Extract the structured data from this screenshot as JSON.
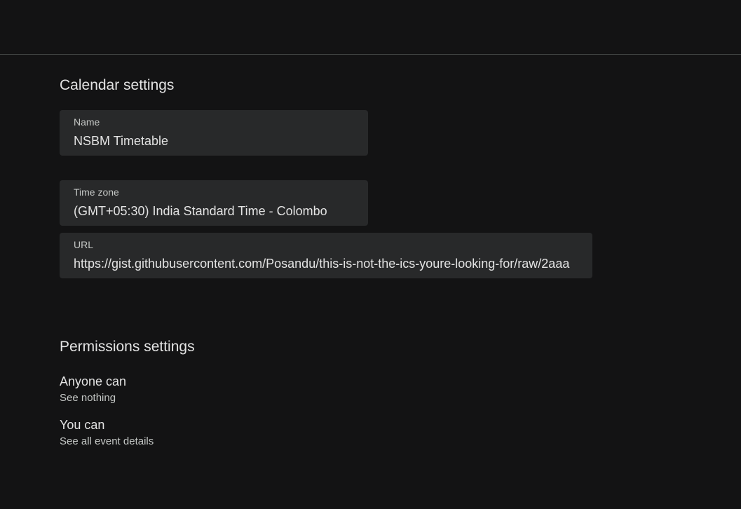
{
  "calendar_settings": {
    "title": "Calendar settings",
    "name_field": {
      "label": "Name",
      "value": "NSBM Timetable"
    },
    "timezone_field": {
      "label": "Time zone",
      "value": "(GMT+05:30) India Standard Time - Colombo"
    },
    "url_field": {
      "label": "URL",
      "value": "https://gist.githubusercontent.com/Posandu/this-is-not-the-ics-youre-looking-for/raw/2aaa"
    }
  },
  "permissions_settings": {
    "title": "Permissions settings",
    "anyone": {
      "heading": "Anyone can",
      "value": "See nothing"
    },
    "you": {
      "heading": "You can",
      "value": "See all event details"
    }
  },
  "colors": {
    "background": "#131314",
    "field_background": "#28292a",
    "divider": "#444746"
  }
}
